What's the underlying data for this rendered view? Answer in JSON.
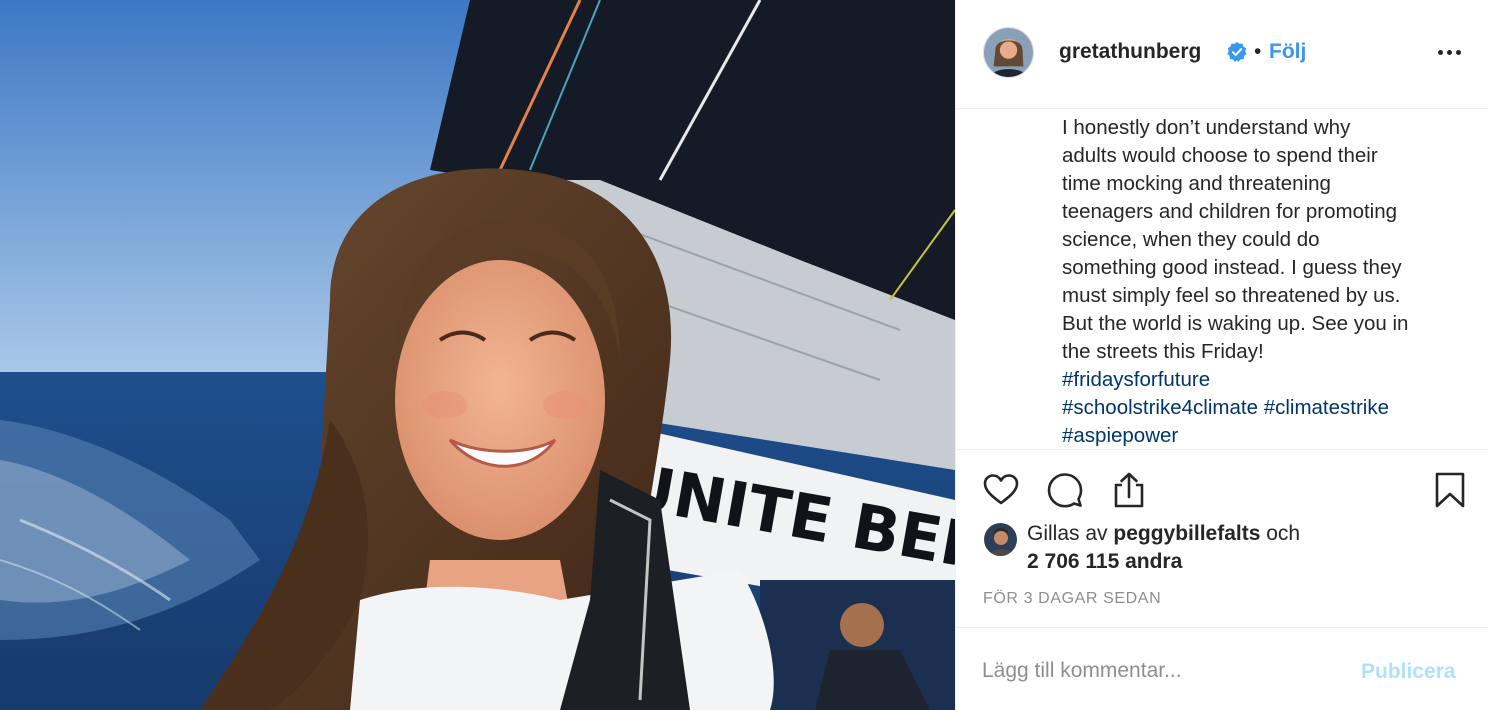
{
  "post": {
    "username": "gretathunberg",
    "verified": true,
    "separator": "•",
    "follow_label": "Följ",
    "more_icon": "more-options-icon"
  },
  "caption": {
    "lines": [
      "I honestly don’t understand why",
      "adults would choose to spend their",
      "time mocking and threatening",
      "teenagers and children for promoting",
      "science, when they could do",
      "something good instead. I guess they",
      "must simply feel so threatened by us.",
      "But the world is waking up. See you in",
      "the streets this Friday!"
    ],
    "hashtags": {
      "tag1": "#fridaysforfuture",
      "tag2": "#schoolstrike4climate",
      "tag3": "#climatestrike",
      "tag4": "#aspiepower"
    }
  },
  "actions": {
    "like_icon": "heart-icon",
    "comment_icon": "comment-icon",
    "share_icon": "share-icon",
    "save_icon": "bookmark-icon"
  },
  "likes": {
    "prefix": "Gillas av",
    "user": "peggybillefalts",
    "conjunction": "och",
    "others": "2 706 115 andra"
  },
  "timestamp": "FÖR 3 DAGAR SEDAN",
  "comment": {
    "placeholder": "Lägg till kommentar...",
    "publish_label": "Publicera"
  },
  "photo": {
    "sail_text": "UNITE BEHI"
  },
  "colors": {
    "accent": "#3897f0",
    "hashtag": "#003569",
    "muted": "#8e8e8e",
    "publish_disabled": "#b2dffc",
    "text": "#262626"
  }
}
